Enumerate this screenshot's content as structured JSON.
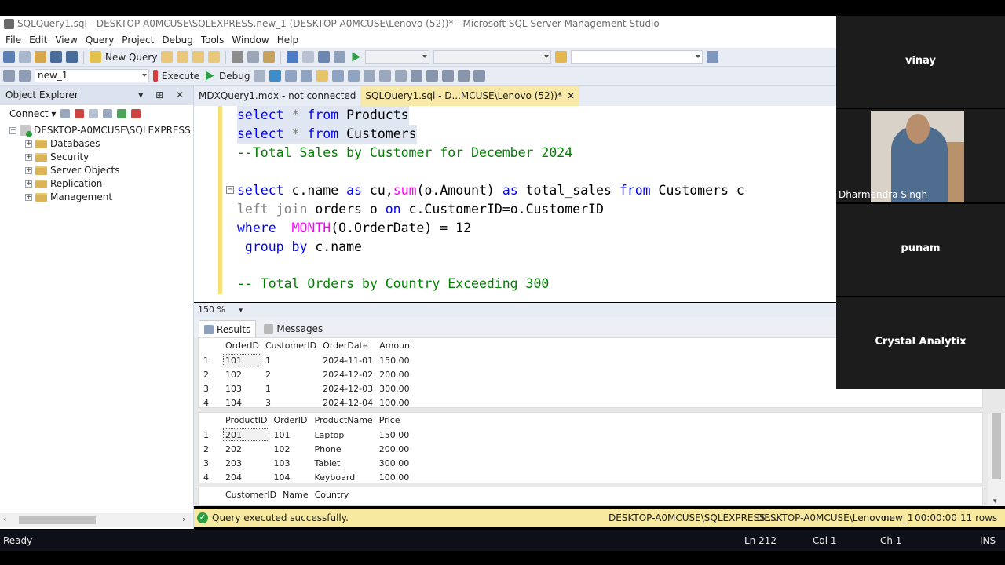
{
  "window": {
    "title": "SQLQuery1.sql - DESKTOP-A0MCUSE\\SQLEXPRESS.new_1 (DESKTOP-A0MCUSE\\Lenovo (52))* - Microsoft SQL Server Management Studio"
  },
  "menu": [
    "File",
    "Edit",
    "View",
    "Query",
    "Project",
    "Debug",
    "Tools",
    "Window",
    "Help"
  ],
  "toolbar": {
    "new_query": "New Query",
    "execute": "Execute",
    "debug": "Debug",
    "database": "new_1"
  },
  "object_explorer": {
    "title": "Object Explorer",
    "header_buttons": "▾ ⊞ ✕",
    "connect": "Connect ▾",
    "server": "DESKTOP-A0MCUSE\\SQLEXPRESS (SQL",
    "nodes": [
      "Databases",
      "Security",
      "Server Objects",
      "Replication",
      "Management"
    ]
  },
  "tabs": [
    {
      "label": "MDXQuery1.mdx - not connected"
    },
    {
      "label": "SQLQuery1.sql - D...MCUSE\\Lenovo (52))*"
    }
  ],
  "editor": {
    "line1": {
      "kw1": "select",
      "star": " * ",
      "kw2": "from",
      "tbl": " Products"
    },
    "line2": {
      "kw1": "select",
      "star": " * ",
      "kw2": "from",
      "tbl": " Customers"
    },
    "line3": "--Total Sales by Customer for December 2024",
    "line4": {
      "a": "select",
      "b": " c.name ",
      "c": "as",
      "d": " cu,",
      "e": "sum",
      "f": "(o.Amount) ",
      "g": "as",
      "h": " total_sales ",
      "i": "from",
      "j": " Customers c"
    },
    "line5": {
      "a": "left join",
      "b": " orders o ",
      "c": "on",
      "d": " c.CustomerID=o.CustomerID"
    },
    "line6": {
      "a": "where",
      "b": "  ",
      "c": "MONTH",
      "d": "(O.OrderDate) = 12"
    },
    "line7": {
      "a": " group by",
      "b": " c.name"
    },
    "line8": "-- Total Orders by Country Exceeding 300"
  },
  "zoom": "150 %",
  "result_tabs": [
    "Results",
    "Messages"
  ],
  "orders": {
    "columns": [
      "OrderID",
      "CustomerID",
      "OrderDate",
      "Amount"
    ],
    "rows": [
      [
        "1",
        "101",
        "1",
        "2024-11-01",
        "150.00"
      ],
      [
        "2",
        "102",
        "2",
        "2024-12-02",
        "200.00"
      ],
      [
        "3",
        "103",
        "1",
        "2024-12-03",
        "300.00"
      ],
      [
        "4",
        "104",
        "3",
        "2024-12-04",
        "100.00"
      ]
    ]
  },
  "products": {
    "columns": [
      "ProductID",
      "OrderID",
      "ProductName",
      "Price"
    ],
    "rows": [
      [
        "1",
        "201",
        "101",
        "Laptop",
        "150.00"
      ],
      [
        "2",
        "202",
        "102",
        "Phone",
        "200.00"
      ],
      [
        "3",
        "203",
        "103",
        "Tablet",
        "300.00"
      ],
      [
        "4",
        "204",
        "104",
        "Keyboard",
        "100.00"
      ]
    ]
  },
  "customers": {
    "columns": [
      "CustomerID",
      "Name",
      "Country"
    ]
  },
  "status": {
    "message": "Query executed successfully.",
    "server": "DESKTOP-A0MCUSE\\SQLEXPRESS ...",
    "user": "DESKTOP-A0MCUSE\\Lenovo...",
    "db": "new_1",
    "time": "00:00:00",
    "rows": "11 rows"
  },
  "app_status": {
    "ready": "Ready",
    "ln": "Ln 212",
    "col": "Col 1",
    "ch": "Ch 1",
    "ins": "INS"
  },
  "participants": [
    "vinay",
    "Dharmendra Singh",
    "punam",
    "Crystal Analytix"
  ]
}
